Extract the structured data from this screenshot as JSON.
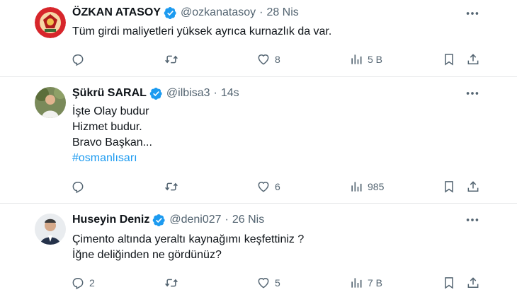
{
  "tweets": [
    {
      "name": "ÖZKAN ATASOY",
      "handle": "@ozkanatasoy",
      "separator": "·",
      "time": "28 Nis",
      "text_lines": [
        "Tüm girdi maliyetleri yüksek ayrıca kurnazlık da var."
      ],
      "reply_count": "",
      "retweet_count": "",
      "like_count": "8",
      "view_count": "5 B",
      "icons": {
        "reply": "reply-icon",
        "retweet": "retweet-icon",
        "like": "heart-icon",
        "views": "views-icon",
        "bookmark": "bookmark-icon",
        "share": "share-icon",
        "more": "more-icon",
        "verified": "verified-badge-icon"
      }
    },
    {
      "name": "Şükrü SARAL",
      "handle": "@ilbisa3",
      "separator": "·",
      "time": "14s",
      "text_lines": [
        "İşte Olay budur",
        "Hizmet budur.",
        "Bravo Başkan..."
      ],
      "hashtag": "#osmanlısarı",
      "reply_count": "",
      "retweet_count": "",
      "like_count": "6",
      "view_count": "985"
    },
    {
      "name": "Huseyin Deniz",
      "handle": "@deni027",
      "separator": "·",
      "time": "26 Nis",
      "text_lines": [
        "Çimento altında yeraltı kaynağımı keşfettiniz ?",
        "İğne deliğinden ne gördünüz?"
      ],
      "reply_count": "2",
      "retweet_count": "",
      "like_count": "5",
      "view_count": "7 B"
    }
  ],
  "colors": {
    "text": "#0f1419",
    "secondary": "#536471",
    "accent": "#1d9bf0",
    "divider": "#e7e9ea"
  }
}
